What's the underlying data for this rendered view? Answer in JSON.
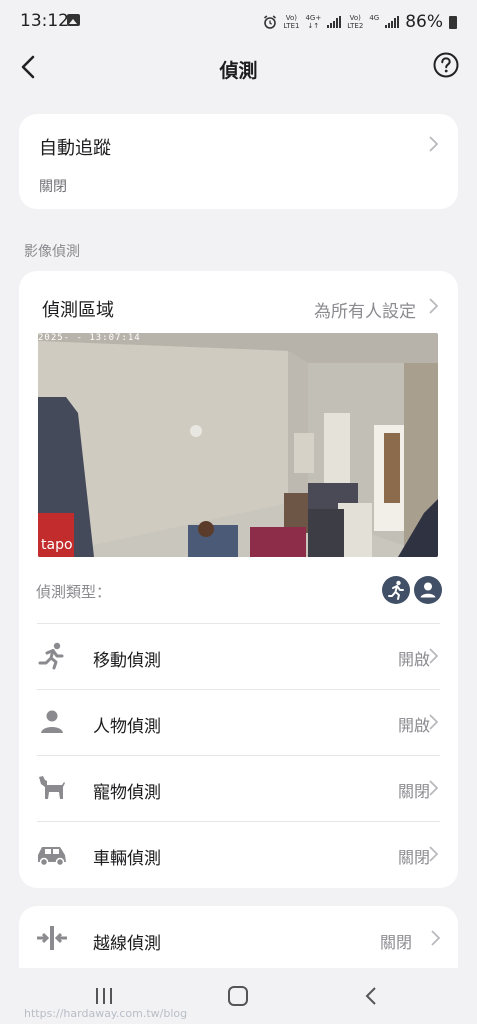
{
  "status_bar": {
    "time": "13:12",
    "carrier1_top": "Vo)",
    "carrier1_mid": "LTE1",
    "net1": "4G+",
    "carrier2_top": "Vo)",
    "carrier2_mid": "LTE2",
    "net2": "4G",
    "battery": "86%",
    "icons": [
      "gallery-icon",
      "alarm-icon",
      "signal-icon",
      "battery-icon"
    ]
  },
  "header": {
    "title": "偵測",
    "back_icon": "chevron-left-icon",
    "help_icon": "question-circle-icon"
  },
  "auto_tracking": {
    "label": "自動追蹤",
    "value": "關閉"
  },
  "section_header": "影像偵測",
  "detection_zone": {
    "label": "偵測區域",
    "value": "為所有人設定",
    "preview": {
      "timestamp": "2025-  -   13:07:14",
      "watermark": "tapo"
    }
  },
  "detection_types": {
    "label": "偵測類型：",
    "active_icons": [
      "running-person-icon",
      "person-icon"
    ]
  },
  "detection_rows": [
    {
      "label": "移動偵測",
      "value": "開啟",
      "icon": "running-person-icon"
    },
    {
      "label": "人物偵測",
      "value": "開啟",
      "icon": "person-icon"
    },
    {
      "label": "寵物偵測",
      "value": "關閉",
      "icon": "dog-icon"
    },
    {
      "label": "車輛偵測",
      "value": "關閉",
      "icon": "car-icon"
    }
  ],
  "line_crossing": {
    "label": "越線偵測",
    "value": "關閉",
    "icon": "line-crossing-icon"
  },
  "nav_bar": {
    "url": "https://hardaway.com.tw/blog",
    "buttons": [
      "recent-apps-icon",
      "home-icon",
      "back-icon"
    ]
  },
  "colors": {
    "background": "#f2f2f4",
    "card": "#ffffff",
    "secondary_text": "#8b8b90",
    "icon_gray": "#8a8a8f",
    "type_icon_bg": "#415066"
  }
}
